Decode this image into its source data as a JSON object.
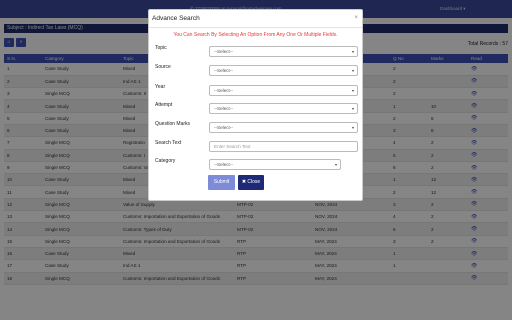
{
  "topbar": {
    "contact": "✆ 7738030086   ✉ support@cstudywinner.com",
    "user": "Dashboard ▾"
  },
  "subject": {
    "label": "Subject : Indirect Tax Laws (MCQ)"
  },
  "toolbar": {
    "home_icon": "home-icon",
    "search_icon": "search-icon",
    "total_records": "Total Records : 57"
  },
  "table": {
    "headers": [
      "S.N.",
      "Category",
      "Topic",
      "",
      "",
      "Q No",
      "Marks",
      "Read"
    ],
    "rows": [
      [
        "1",
        "Case Study",
        "Mixed",
        "",
        "",
        "2",
        "",
        "👁"
      ],
      [
        "2",
        "Case Study",
        "Ind AS 1",
        "",
        "",
        "2",
        "",
        "👁"
      ],
      [
        "3",
        "Single MCQ",
        "Customs: Ir",
        "",
        "",
        "2",
        "",
        "👁"
      ],
      [
        "4",
        "Case Study",
        "Mixed",
        "",
        "",
        "1",
        "10",
        "👁"
      ],
      [
        "5",
        "Case Study",
        "Mixed",
        "",
        "",
        "2",
        "6",
        "👁"
      ],
      [
        "6",
        "Case Study",
        "Mixed",
        "",
        "",
        "3",
        "8",
        "👁"
      ],
      [
        "7",
        "Single MCQ",
        "Registratio",
        "",
        "",
        "4",
        "2",
        "👁"
      ],
      [
        "8",
        "Single MCQ",
        "Customs: I",
        "",
        "",
        "5",
        "2",
        "👁"
      ],
      [
        "9",
        "Single MCQ",
        "Customs: Va",
        "",
        "",
        "6",
        "2",
        "👁"
      ],
      [
        "10",
        "Case Study",
        "Mixed",
        "MTP-02",
        "NOV, 2024",
        "1",
        "12",
        "👁"
      ],
      [
        "11",
        "Case Study",
        "Mixed",
        "MTP-02",
        "NOV, 2024",
        "2",
        "12",
        "👁"
      ],
      [
        "12",
        "Single MCQ",
        "Value of Supply",
        "MTP-02",
        "NOV, 2024",
        "3",
        "2",
        "👁"
      ],
      [
        "13",
        "Single MCQ",
        "Customs: Importation and Exportation of Goods",
        "MTP-02",
        "NOV, 2024",
        "4",
        "2",
        "👁"
      ],
      [
        "14",
        "Single MCQ",
        "Customs: Types of Duty",
        "MTP-02",
        "NOV, 2024",
        "5",
        "2",
        "👁"
      ],
      [
        "15",
        "Single MCQ",
        "Customs: Importation and Exportation of Goods",
        "RTP",
        "MAY, 2024",
        "3",
        "2",
        "👁"
      ],
      [
        "16",
        "Case Study",
        "Mixed",
        "RTP",
        "MAY, 2024",
        "1",
        "",
        "👁"
      ],
      [
        "17",
        "Case Study",
        "Ind AS 1",
        "RTP",
        "MAY, 2024",
        "1",
        "",
        "👁"
      ],
      [
        "18",
        "Single MCQ",
        "Customs: Importation and Exportation of Goods",
        "RTP",
        "MAY, 2024",
        "",
        "",
        "👁"
      ]
    ]
  },
  "modal": {
    "title": "Advance Search",
    "close_glyph": "×",
    "notice": "You Can Search By Selecting An Option From Any One Or Multiple Fields.",
    "fields": {
      "topic": {
        "label": "Topic",
        "value": "--Select--"
      },
      "source": {
        "label": "Source",
        "value": "--Select--"
      },
      "year": {
        "label": "Year",
        "value": "--Select--"
      },
      "attempt": {
        "label": "Attempt",
        "value": "--Select--"
      },
      "question_marks": {
        "label": "Question Marks",
        "value": "--Select--"
      },
      "search_text": {
        "label": "Search Text",
        "placeholder": "Enter Search Text"
      },
      "category": {
        "label": "Category",
        "value": "--Select--"
      }
    },
    "submit_label": "Submit",
    "close_label": "✖ Close"
  }
}
